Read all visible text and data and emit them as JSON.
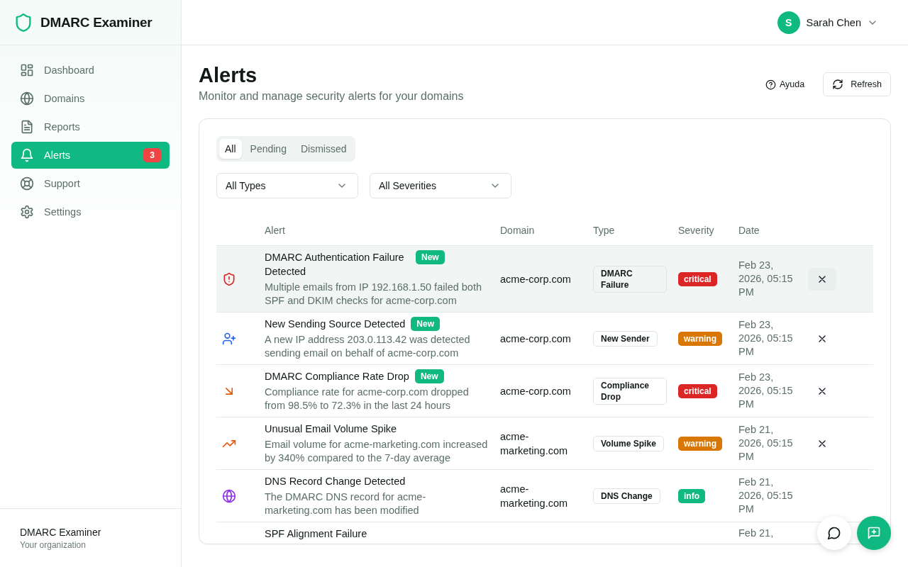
{
  "brand": {
    "name": "DMARC Examiner"
  },
  "sidebar": {
    "items": [
      {
        "label": "Dashboard",
        "selected": false
      },
      {
        "label": "Domains",
        "selected": false
      },
      {
        "label": "Reports",
        "selected": false
      },
      {
        "label": "Alerts",
        "selected": true,
        "badge": "3"
      },
      {
        "label": "Support",
        "selected": false
      },
      {
        "label": "Settings",
        "selected": false
      }
    ],
    "footer": {
      "name": "DMARC Examiner",
      "subtitle": "Your organization"
    }
  },
  "user": {
    "initial": "S",
    "name": "Sarah Chen"
  },
  "page": {
    "title": "Alerts",
    "subtitle": "Monitor and manage security alerts for your domains",
    "help": "Ayuda",
    "refresh": "Refresh"
  },
  "tabs": [
    {
      "label": "All",
      "selected": true
    },
    {
      "label": "Pending",
      "selected": false
    },
    {
      "label": "Dismissed",
      "selected": false
    }
  ],
  "filters": [
    {
      "value": "All Types"
    },
    {
      "value": "All Severities"
    }
  ],
  "table": {
    "columns": [
      "Alert",
      "Domain",
      "Type",
      "Severity",
      "Date"
    ],
    "rows": [
      {
        "kind": "auth",
        "title": "DMARC Authentication Failure Detected",
        "badge": "New",
        "description": "Multiple emails from IP 192.168.1.50 failed both SPF and DKIM checks for acme-corp.com",
        "domain": "acme-corp.com",
        "type": "DMARC Failure",
        "severity": {
          "label": "critical",
          "color": "#dc2626"
        },
        "date": "Feb 23, 2026, 05:15 PM",
        "dismiss": true,
        "hovered": true
      },
      {
        "kind": "sender",
        "title": "New Sending Source Detected",
        "badge": "New",
        "description": "A new IP address 203.0.113.42 was detected sending email on behalf of acme-corp.com",
        "domain": "acme-corp.com",
        "type": "New Sender",
        "severity": {
          "label": "warning",
          "color": "#d97706"
        },
        "date": "Feb 23, 2026, 05:15 PM",
        "dismiss": true,
        "hovered": false
      },
      {
        "kind": "drop",
        "title": "DMARC Compliance Rate Drop",
        "badge": "New",
        "description": "Compliance rate for acme-corp.com dropped from 98.5% to 72.3% in the last 24 hours",
        "domain": "acme-corp.com",
        "type": "Compliance Drop",
        "severity": {
          "label": "critical",
          "color": "#dc2626"
        },
        "date": "Feb 23, 2026, 05:15 PM",
        "dismiss": true,
        "hovered": false
      },
      {
        "kind": "spike",
        "title": "Unusual Email Volume Spike",
        "description": "Email volume for acme-marketing.com increased by 340% compared to the 7-day average",
        "domain": "acme-marketing.com",
        "type": "Volume Spike",
        "severity": {
          "label": "warning",
          "color": "#d97706"
        },
        "date": "Feb 21, 2026, 05:15 PM",
        "dismiss": true,
        "hovered": false
      },
      {
        "kind": "dns",
        "title": "DNS Record Change Detected",
        "description": "The DMARC DNS record for acme-marketing.com has been modified",
        "domain": "acme-marketing.com",
        "type": "DNS Change",
        "severity": {
          "label": "info",
          "color": "#10b981"
        },
        "date": "Feb 21, 2026, 05:15 PM",
        "dismiss": false,
        "hovered": false
      }
    ],
    "partial_row": {
      "title": "SPF Alignment Failure",
      "date": "Feb 21,"
    }
  }
}
